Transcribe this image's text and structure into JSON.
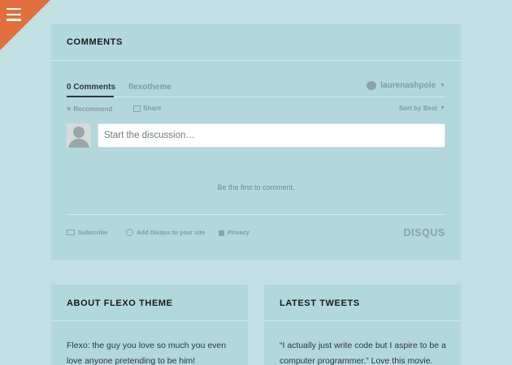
{
  "menu": {
    "icon": "hamburger-menu-icon",
    "accent": "#e2703e"
  },
  "comments": {
    "title": "COMMENTS",
    "count_tab": "0 Comments",
    "forum_tab": "flexotheme",
    "user": "laurenashpole",
    "recommend": "Recommend",
    "share": "Share",
    "sort": "Sort by Best",
    "input_placeholder": "Start the discussion…",
    "empty_message": "Be the first to comment.",
    "footer": {
      "subscribe": "Subscribe",
      "add_disqus": "Add Disqus to your site",
      "privacy": "Privacy",
      "logo": "DISQUS"
    }
  },
  "about": {
    "title": "ABOUT FLEXO THEME",
    "text": "Flexo: the guy you love so much you even love anyone pretending to be him!"
  },
  "tweets": {
    "title": "LATEST TWEETS",
    "text": "“I actually just write code but I aspire to be a computer programmer.” Love this movie."
  }
}
